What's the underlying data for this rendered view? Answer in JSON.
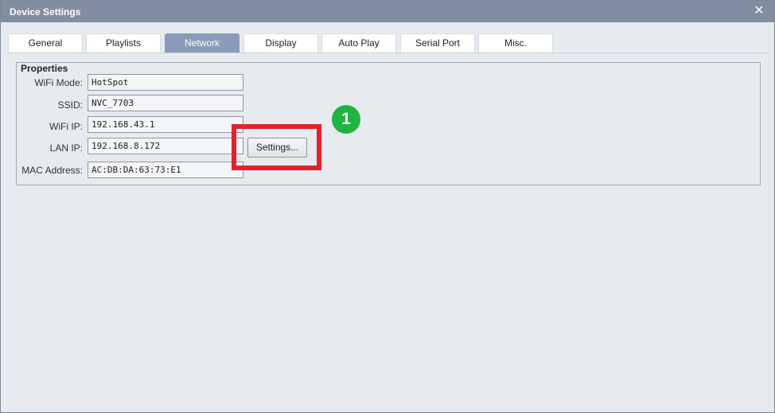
{
  "window": {
    "title": "Device Settings",
    "close_glyph": "✕"
  },
  "tabs": [
    {
      "label": "General",
      "active": false
    },
    {
      "label": "Playlists",
      "active": false
    },
    {
      "label": "Network",
      "active": true
    },
    {
      "label": "Display",
      "active": false
    },
    {
      "label": "Auto Play",
      "active": false
    },
    {
      "label": "Serial Port",
      "active": false
    },
    {
      "label": "Misc.",
      "active": false
    }
  ],
  "properties": {
    "legend": "Properties",
    "fields": [
      {
        "label": "WiFi Mode:",
        "value": "HotSpot"
      },
      {
        "label": "SSID:",
        "value": "NVC_7703"
      },
      {
        "label": "WiFi IP:",
        "value": "192.168.43.1"
      },
      {
        "label": "LAN IP:",
        "value": "192.168.8.172"
      },
      {
        "label": "MAC Address:",
        "value": "AC:DB:DA:63:73:E1"
      }
    ],
    "settings_button": "Settings..."
  },
  "annotation": {
    "step_number": "1",
    "highlight_color": "#e3212c",
    "badge_color": "#1fb43f"
  },
  "colors": {
    "titlebar": "#838da0",
    "active_tab": "#8a9bba",
    "background": "#e7eaef"
  },
  "icons": {
    "close": "close-icon"
  }
}
